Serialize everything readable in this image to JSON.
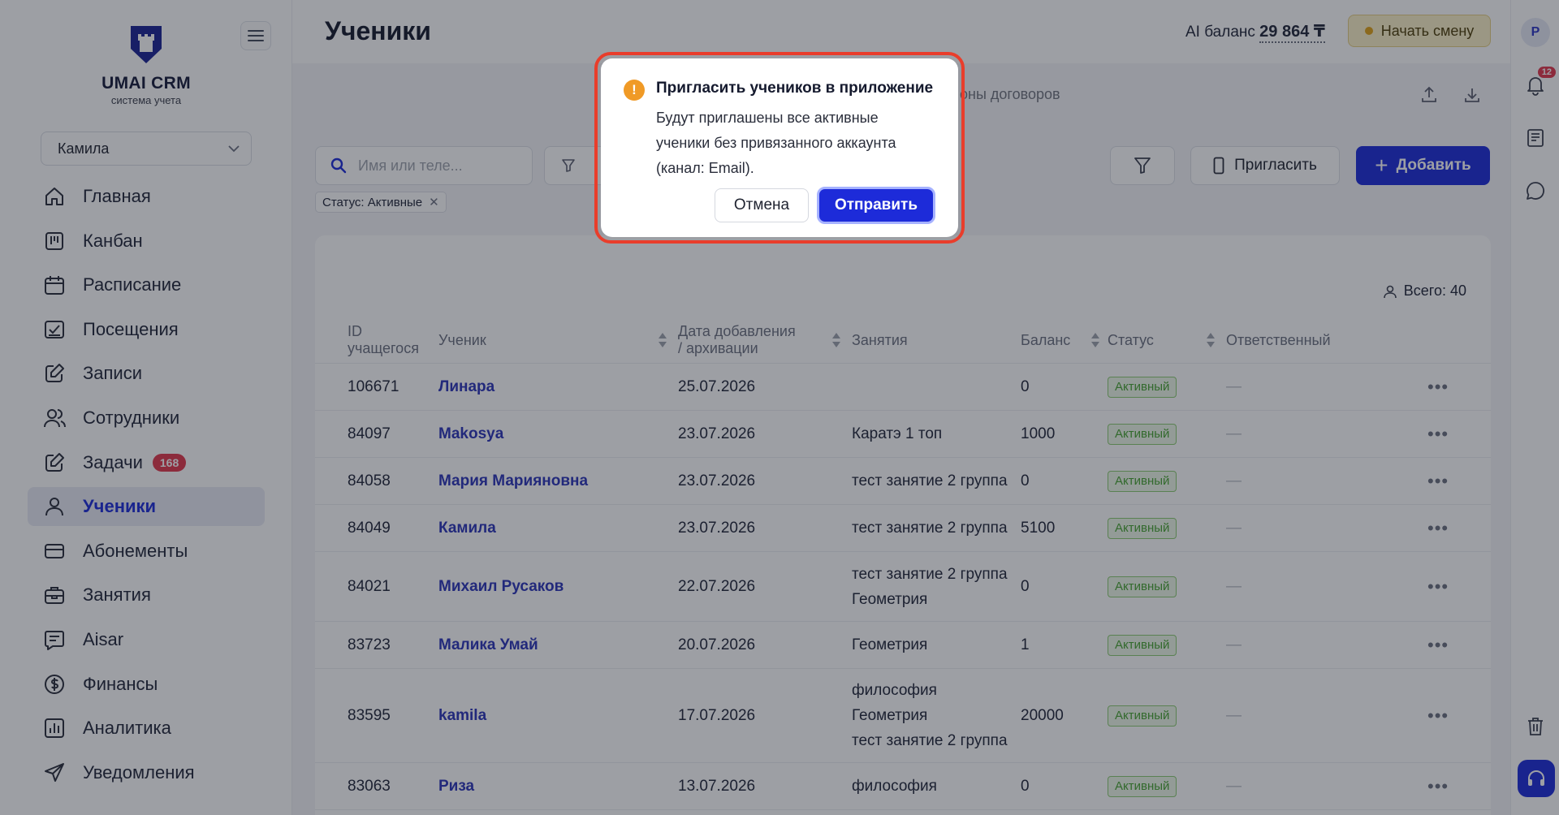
{
  "brand": {
    "name": "UMAI CRM",
    "tagline": "система учета"
  },
  "branch_select": {
    "value": "Камила"
  },
  "nav": [
    {
      "label": "Главная",
      "icon": "home-icon"
    },
    {
      "label": "Канбан",
      "icon": "kanban-icon"
    },
    {
      "label": "Расписание",
      "icon": "calendar-icon"
    },
    {
      "label": "Посещения",
      "icon": "attendance-icon"
    },
    {
      "label": "Записи",
      "icon": "edit-icon"
    },
    {
      "label": "Сотрудники",
      "icon": "staff-icon"
    },
    {
      "label": "Задачи",
      "icon": "tasks-icon",
      "badge": "168"
    },
    {
      "label": "Ученики",
      "icon": "user-icon",
      "active": true
    },
    {
      "label": "Абонементы",
      "icon": "card-icon"
    },
    {
      "label": "Занятия",
      "icon": "briefcase-icon"
    },
    {
      "label": "Aisar",
      "icon": "chat-doc-icon"
    },
    {
      "label": "Финансы",
      "icon": "dollar-icon"
    },
    {
      "label": "Аналитика",
      "icon": "chart-icon"
    },
    {
      "label": "Уведомления",
      "icon": "send-icon"
    }
  ],
  "header": {
    "title": "Ученики",
    "ai_label": "AI баланс",
    "ai_value": "29 864 ₸",
    "shift_button": "Начать смену"
  },
  "rail": {
    "avatar": "P",
    "notifications": "12"
  },
  "tabs": {
    "contracts_partial": "оны договоров"
  },
  "toolbar": {
    "search_placeholder": "Имя или теле...",
    "filter_chip": "Статус: Активные",
    "invite_button": "Пригласить",
    "add_button": "Добавить"
  },
  "table": {
    "total": "Всего: 40",
    "headers": {
      "id_line1": "ID",
      "id_line2": "учащегося",
      "student": "Ученик",
      "date_line1": "Дата добавления",
      "date_line2": "/ архивации",
      "lessons": "Занятия",
      "balance": "Баланс",
      "status": "Статус",
      "responsible": "Ответственный"
    },
    "rows": [
      {
        "id": "106671",
        "name": "Линара",
        "date": "25.07.2026",
        "lessons": [],
        "balance": "0",
        "status": "Активный",
        "responsible": "—"
      },
      {
        "id": "84097",
        "name": "Makosya",
        "date": "23.07.2026",
        "lessons": [
          "Каратэ 1 топ"
        ],
        "balance": "1000",
        "status": "Активный",
        "responsible": "—"
      },
      {
        "id": "84058",
        "name": "Мария Марияновна",
        "date": "23.07.2026",
        "lessons": [
          "тест занятие 2 группа"
        ],
        "balance": "0",
        "status": "Активный",
        "responsible": "—"
      },
      {
        "id": "84049",
        "name": "Камила",
        "date": "23.07.2026",
        "lessons": [
          "тест занятие 2 группа"
        ],
        "balance": "5100",
        "status": "Активный",
        "responsible": "—"
      },
      {
        "id": "84021",
        "name": "Михаил Русаков",
        "date": "22.07.2026",
        "lessons": [
          "тест занятие 2 группа",
          "Геометрия"
        ],
        "balance": "0",
        "status": "Активный",
        "responsible": "—"
      },
      {
        "id": "83723",
        "name": "Малика Умай",
        "date": "20.07.2026",
        "lessons": [
          "Геометрия"
        ],
        "balance": "1",
        "status": "Активный",
        "responsible": "—"
      },
      {
        "id": "83595",
        "name": "kamila",
        "date": "17.07.2026",
        "lessons": [
          "философия",
          "Геометрия",
          "тест занятие 2 группа"
        ],
        "balance": "20000",
        "status": "Активный",
        "responsible": "—"
      },
      {
        "id": "83063",
        "name": "Риза",
        "date": "13.07.2026",
        "lessons": [
          "философия"
        ],
        "balance": "0",
        "status": "Активный",
        "responsible": "—"
      }
    ]
  },
  "dialog": {
    "title": "Пригласить учеников в приложение",
    "message": "Будут приглашены все активные ученики без привязанного аккаунта (канал: Email).",
    "cancel": "Отмена",
    "confirm": "Отправить"
  },
  "colors": {
    "accent": "#1d2bd9",
    "badge_red": "#e2384d",
    "status_green": "#48a432",
    "warning_orange": "#f09a26",
    "dialog_highlight": "#e93d2b"
  }
}
